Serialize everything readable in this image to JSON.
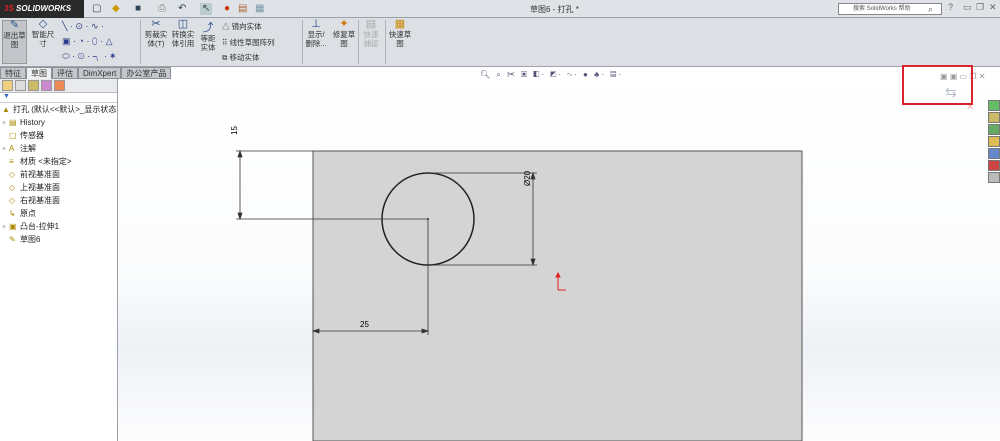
{
  "app": {
    "logo": "SOLIDWORKS",
    "window_title": "草图6 - 打孔 *",
    "search_placeholder": "搜索 SolidWorks 帮助"
  },
  "ribbon": {
    "exit_sketch": "退出草图",
    "smart_dim": "智能尺寸",
    "trim": "剪裁实体(T)",
    "convert": "转换实体引用",
    "offset": "等距实体",
    "mirror": "镜向实体",
    "linear_pattern": "线性草图阵列",
    "move": "移动实体",
    "show_delete": "显示/删除...",
    "repair": "修复草图",
    "quick_snap": "快速捕捉",
    "rapid_sketch": "快速草图"
  },
  "tabs": [
    {
      "label": "特征"
    },
    {
      "label": "草图"
    },
    {
      "label": "评估"
    },
    {
      "label": "DimXpert"
    },
    {
      "label": "办公室产品"
    }
  ],
  "tree": {
    "root": "打孔 (默认<<默认>_显示状态",
    "items": [
      {
        "label": "History",
        "expand": "+"
      },
      {
        "label": "传感器",
        "expand": ""
      },
      {
        "label": "注解",
        "expand": "+"
      },
      {
        "label": "材质 <未指定>",
        "expand": ""
      },
      {
        "label": "前视基准面",
        "expand": ""
      },
      {
        "label": "上视基准面",
        "expand": ""
      },
      {
        "label": "右视基准面",
        "expand": ""
      },
      {
        "label": "原点",
        "expand": ""
      },
      {
        "label": "凸台-拉伸1",
        "expand": "+"
      },
      {
        "label": "草图6",
        "expand": ""
      }
    ]
  },
  "sketch": {
    "dim_vertical": "15",
    "dim_horizontal": "25",
    "dim_diameter": "Ø20"
  },
  "colors": {
    "highlight": "#d9232e",
    "origin": "#e02020",
    "plate": "#d4d4d4"
  }
}
